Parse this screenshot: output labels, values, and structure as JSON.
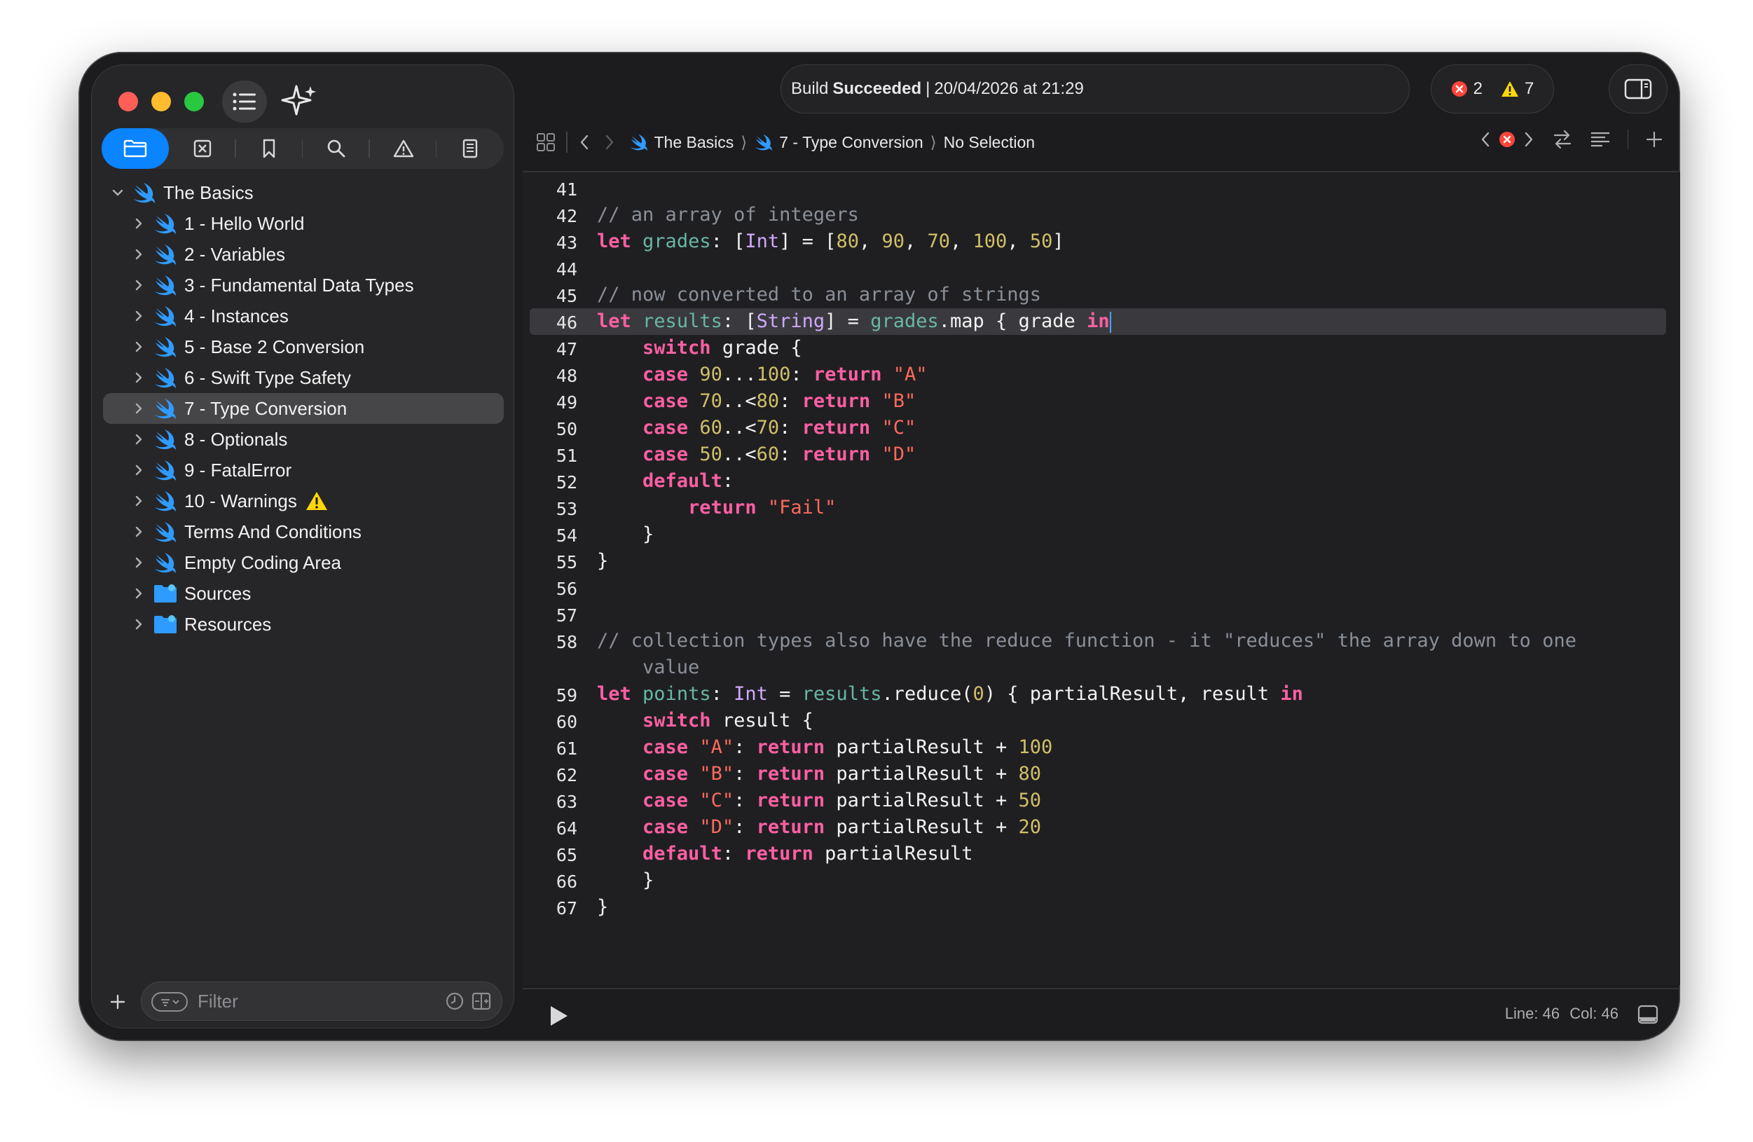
{
  "window": {
    "build_status": {
      "prefix": "Build",
      "status": "Succeeded",
      "separator": "|",
      "timestamp": "20/04/2026 at 21:29"
    },
    "issues": {
      "errors": "2",
      "warnings": "7"
    }
  },
  "sidebar": {
    "filter_placeholder": "Filter",
    "root": {
      "label": "The Basics"
    },
    "items": [
      {
        "label": "1 - Hello World",
        "kind": "swift"
      },
      {
        "label": "2 - Variables",
        "kind": "swift"
      },
      {
        "label": "3 - Fundamental Data Types",
        "kind": "swift"
      },
      {
        "label": "4 - Instances",
        "kind": "swift"
      },
      {
        "label": "5 - Base 2 Conversion",
        "kind": "swift"
      },
      {
        "label": "6 - Swift Type Safety",
        "kind": "swift"
      },
      {
        "label": "7 - Type Conversion",
        "kind": "swift",
        "selected": true
      },
      {
        "label": "8 - Optionals",
        "kind": "swift"
      },
      {
        "label": "9 - FatalError",
        "kind": "swift"
      },
      {
        "label": "10 - Warnings",
        "kind": "swift",
        "warning": true
      },
      {
        "label": "Terms And Conditions",
        "kind": "swift"
      },
      {
        "label": "Empty Coding Area",
        "kind": "swift"
      },
      {
        "label": "Sources",
        "kind": "folder"
      },
      {
        "label": "Resources",
        "kind": "folder"
      }
    ],
    "nav_tabs": [
      "folder-icon",
      "x-square-icon",
      "bookmark-icon",
      "search-icon",
      "warning-icon",
      "report-icon"
    ]
  },
  "jumpbar": {
    "crumbs": [
      "The Basics",
      "7 - Type Conversion",
      "No Selection"
    ]
  },
  "editor": {
    "current_line": 46,
    "lines": [
      {
        "n": "41",
        "tokens": []
      },
      {
        "n": "42",
        "tokens": [
          [
            "c",
            "// an array of integers"
          ]
        ]
      },
      {
        "n": "43",
        "tokens": [
          [
            "k",
            "let"
          ],
          [
            "p",
            " "
          ],
          [
            "v",
            "grades"
          ],
          [
            "p",
            ": ["
          ],
          [
            "t",
            "Int"
          ],
          [
            "p",
            "] = ["
          ],
          [
            "n",
            "80"
          ],
          [
            "p",
            ", "
          ],
          [
            "n",
            "90"
          ],
          [
            "p",
            ", "
          ],
          [
            "n",
            "70"
          ],
          [
            "p",
            ", "
          ],
          [
            "n",
            "100"
          ],
          [
            "p",
            ", "
          ],
          [
            "n",
            "50"
          ],
          [
            "p",
            "]"
          ]
        ]
      },
      {
        "n": "44",
        "tokens": []
      },
      {
        "n": "45",
        "tokens": [
          [
            "c",
            "// now converted to an array of strings"
          ]
        ]
      },
      {
        "n": "46",
        "tokens": [
          [
            "k",
            "let"
          ],
          [
            "p",
            " "
          ],
          [
            "v",
            "results"
          ],
          [
            "p",
            ": ["
          ],
          [
            "t",
            "String"
          ],
          [
            "p",
            "] = "
          ],
          [
            "fn",
            "grades"
          ],
          [
            "p",
            ".map { grade "
          ],
          [
            "k",
            "in"
          ]
        ],
        "current": true
      },
      {
        "n": "47",
        "tokens": [
          [
            "p",
            "    "
          ],
          [
            "k",
            "switch"
          ],
          [
            "p",
            " grade {"
          ]
        ]
      },
      {
        "n": "48",
        "tokens": [
          [
            "p",
            "    "
          ],
          [
            "k",
            "case"
          ],
          [
            "p",
            " "
          ],
          [
            "n",
            "90"
          ],
          [
            "p",
            "..."
          ],
          [
            "n",
            "100"
          ],
          [
            "p",
            ": "
          ],
          [
            "k",
            "return"
          ],
          [
            "p",
            " "
          ],
          [
            "s",
            "\"A\""
          ]
        ]
      },
      {
        "n": "49",
        "tokens": [
          [
            "p",
            "    "
          ],
          [
            "k",
            "case"
          ],
          [
            "p",
            " "
          ],
          [
            "n",
            "70"
          ],
          [
            "p",
            "..<"
          ],
          [
            "n",
            "80"
          ],
          [
            "p",
            ": "
          ],
          [
            "k",
            "return"
          ],
          [
            "p",
            " "
          ],
          [
            "s",
            "\"B\""
          ]
        ]
      },
      {
        "n": "50",
        "tokens": [
          [
            "p",
            "    "
          ],
          [
            "k",
            "case"
          ],
          [
            "p",
            " "
          ],
          [
            "n",
            "60"
          ],
          [
            "p",
            "..<"
          ],
          [
            "n",
            "70"
          ],
          [
            "p",
            ": "
          ],
          [
            "k",
            "return"
          ],
          [
            "p",
            " "
          ],
          [
            "s",
            "\"C\""
          ]
        ]
      },
      {
        "n": "51",
        "tokens": [
          [
            "p",
            "    "
          ],
          [
            "k",
            "case"
          ],
          [
            "p",
            " "
          ],
          [
            "n",
            "50"
          ],
          [
            "p",
            "..<"
          ],
          [
            "n",
            "60"
          ],
          [
            "p",
            ": "
          ],
          [
            "k",
            "return"
          ],
          [
            "p",
            " "
          ],
          [
            "s",
            "\"D\""
          ]
        ]
      },
      {
        "n": "52",
        "tokens": [
          [
            "p",
            "    "
          ],
          [
            "k",
            "default"
          ],
          [
            "p",
            ":"
          ]
        ]
      },
      {
        "n": "53",
        "tokens": [
          [
            "p",
            "        "
          ],
          [
            "k",
            "return"
          ],
          [
            "p",
            " "
          ],
          [
            "s",
            "\"Fail\""
          ]
        ]
      },
      {
        "n": "54",
        "tokens": [
          [
            "p",
            "    }"
          ]
        ]
      },
      {
        "n": "55",
        "tokens": [
          [
            "p",
            "}"
          ]
        ]
      },
      {
        "n": "56",
        "tokens": []
      },
      {
        "n": "57",
        "tokens": []
      },
      {
        "n": "58",
        "tokens": [
          [
            "c",
            "// collection types also have the reduce function - it \"reduces\" the array down to one"
          ]
        ]
      },
      {
        "n": "",
        "tokens": [
          [
            "c",
            "    value"
          ]
        ]
      },
      {
        "n": "59",
        "tokens": [
          [
            "k",
            "let"
          ],
          [
            "p",
            " "
          ],
          [
            "v",
            "points"
          ],
          [
            "p",
            ": "
          ],
          [
            "t",
            "Int"
          ],
          [
            "p",
            " = "
          ],
          [
            "fn",
            "results"
          ],
          [
            "p",
            ".reduce("
          ],
          [
            "n",
            "0"
          ],
          [
            "p",
            ") { partialResult, result "
          ],
          [
            "k",
            "in"
          ]
        ]
      },
      {
        "n": "60",
        "tokens": [
          [
            "p",
            "    "
          ],
          [
            "k",
            "switch"
          ],
          [
            "p",
            " result {"
          ]
        ]
      },
      {
        "n": "61",
        "tokens": [
          [
            "p",
            "    "
          ],
          [
            "k",
            "case"
          ],
          [
            "p",
            " "
          ],
          [
            "s",
            "\"A\""
          ],
          [
            "p",
            ": "
          ],
          [
            "k",
            "return"
          ],
          [
            "p",
            " partialResult + "
          ],
          [
            "n",
            "100"
          ]
        ]
      },
      {
        "n": "62",
        "tokens": [
          [
            "p",
            "    "
          ],
          [
            "k",
            "case"
          ],
          [
            "p",
            " "
          ],
          [
            "s",
            "\"B\""
          ],
          [
            "p",
            ": "
          ],
          [
            "k",
            "return"
          ],
          [
            "p",
            " partialResult + "
          ],
          [
            "n",
            "80"
          ]
        ]
      },
      {
        "n": "63",
        "tokens": [
          [
            "p",
            "    "
          ],
          [
            "k",
            "case"
          ],
          [
            "p",
            " "
          ],
          [
            "s",
            "\"C\""
          ],
          [
            "p",
            ": "
          ],
          [
            "k",
            "return"
          ],
          [
            "p",
            " partialResult + "
          ],
          [
            "n",
            "50"
          ]
        ]
      },
      {
        "n": "64",
        "tokens": [
          [
            "p",
            "    "
          ],
          [
            "k",
            "case"
          ],
          [
            "p",
            " "
          ],
          [
            "s",
            "\"D\""
          ],
          [
            "p",
            ": "
          ],
          [
            "k",
            "return"
          ],
          [
            "p",
            " partialResult + "
          ],
          [
            "n",
            "20"
          ]
        ]
      },
      {
        "n": "65",
        "tokens": [
          [
            "p",
            "    "
          ],
          [
            "k",
            "default"
          ],
          [
            "p",
            ": "
          ],
          [
            "k",
            "return"
          ],
          [
            "p",
            " partialResult"
          ]
        ]
      },
      {
        "n": "66",
        "tokens": [
          [
            "p",
            "    }"
          ]
        ]
      },
      {
        "n": "67",
        "tokens": [
          [
            "p",
            "}"
          ]
        ]
      }
    ]
  },
  "statusbar": {
    "line_label": "Line:",
    "line_value": "46",
    "col_label": "Col:",
    "col_value": "46"
  },
  "colors": {
    "keyword": "#fc5fa3",
    "variable": "#67b7a4",
    "type": "#d0a8ff",
    "number": "#d0bf69",
    "string": "#fc6a5d",
    "comment": "#8a8f98",
    "accent": "#0a84ff",
    "swift": "#2f9bff",
    "warning": "#ffd60a",
    "error": "#ff453a"
  }
}
